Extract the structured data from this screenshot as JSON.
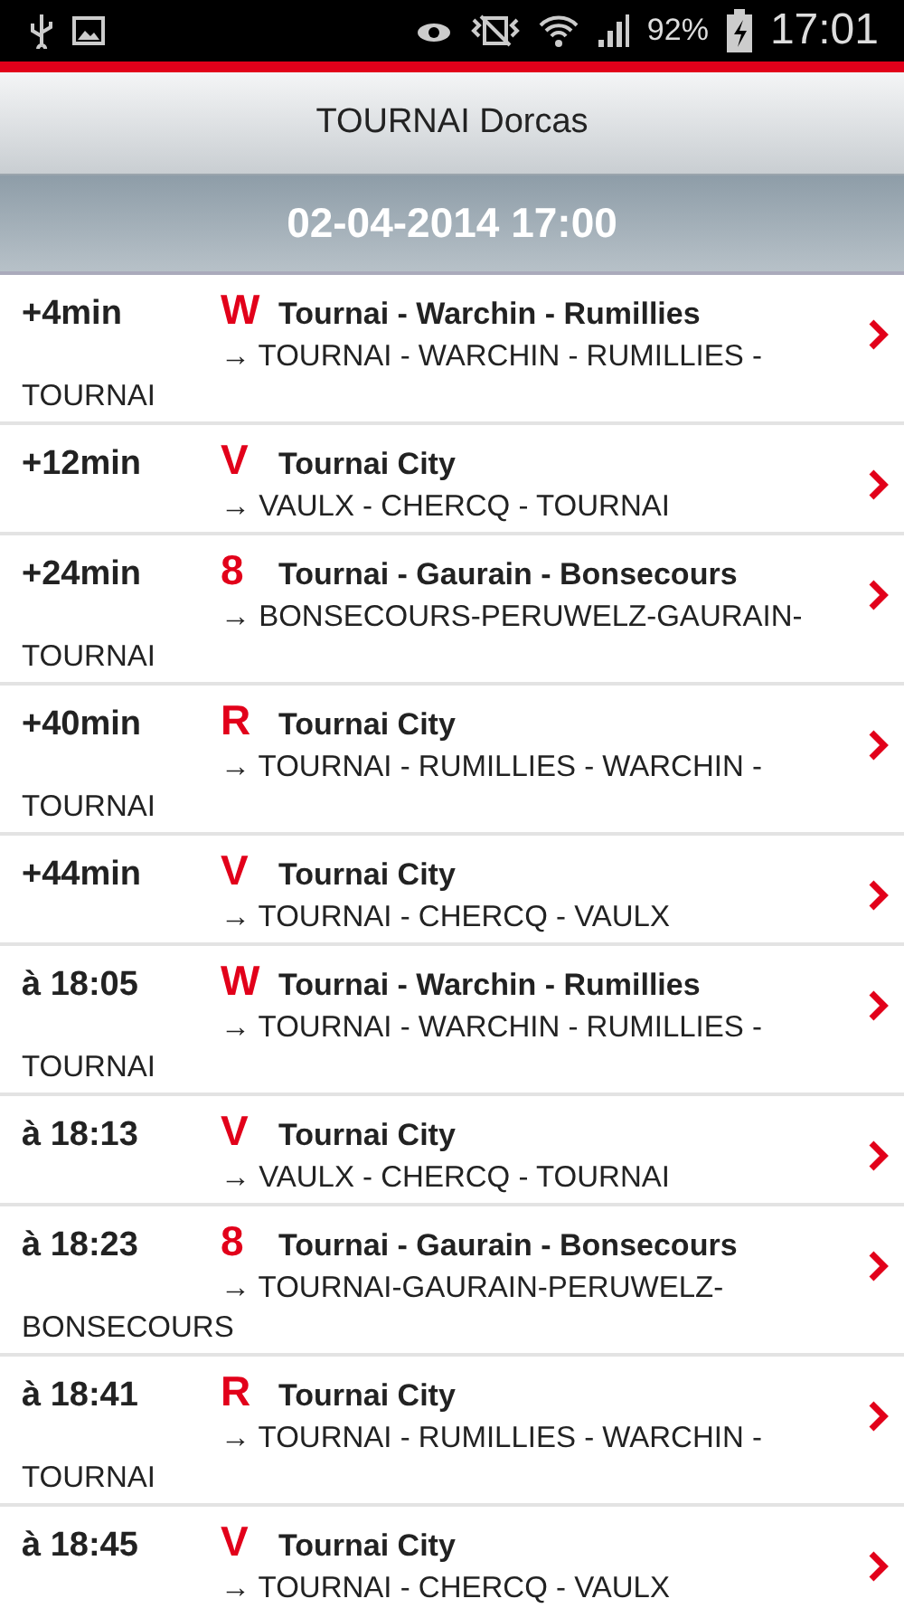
{
  "status_bar": {
    "battery": "92%",
    "time": "17:01"
  },
  "header": {
    "title": "TOURNAI Dorcas"
  },
  "date_bar": {
    "text": "02-04-2014 17:00"
  },
  "departures": [
    {
      "time": "+4min",
      "line": "W",
      "route": "Tournai - Warchin - Rumillies",
      "direction": "→ TOURNAI - WARCHIN - RUMILLIES - TOURNAI"
    },
    {
      "time": "+12min",
      "line": "V",
      "route": "Tournai City",
      "direction": "→ VAULX - CHERCQ - TOURNAI"
    },
    {
      "time": "+24min",
      "line": "8",
      "route": "Tournai - Gaurain - Bonsecours",
      "direction": "→ BONSECOURS-PERUWELZ-GAURAIN-TOURNAI"
    },
    {
      "time": "+40min",
      "line": "R",
      "route": "Tournai City",
      "direction": "→ TOURNAI - RUMILLIES - WARCHIN - TOURNAI"
    },
    {
      "time": "+44min",
      "line": "V",
      "route": "Tournai City",
      "direction": "→ TOURNAI - CHERCQ - VAULX"
    },
    {
      "time": "à 18:05",
      "line": "W",
      "route": "Tournai - Warchin - Rumillies",
      "direction": "→ TOURNAI - WARCHIN - RUMILLIES - TOURNAI"
    },
    {
      "time": "à 18:13",
      "line": "V",
      "route": "Tournai City",
      "direction": "→ VAULX - CHERCQ - TOURNAI"
    },
    {
      "time": "à 18:23",
      "line": "8",
      "route": "Tournai - Gaurain - Bonsecours",
      "direction": "→ TOURNAI-GAURAIN-PERUWELZ-BONSECOURS"
    },
    {
      "time": "à 18:41",
      "line": "R",
      "route": "Tournai City",
      "direction": "→ TOURNAI - RUMILLIES - WARCHIN - TOURNAI"
    },
    {
      "time": "à 18:45",
      "line": "V",
      "route": "Tournai City",
      "direction": "→ TOURNAI - CHERCQ - VAULX"
    }
  ]
}
